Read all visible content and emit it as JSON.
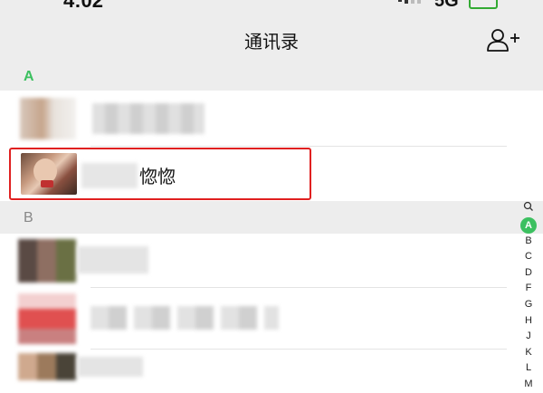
{
  "status_bar": {
    "time": "4:02",
    "network": "5G"
  },
  "header": {
    "title": "通讯录",
    "add_contact_icon": "add-contact-icon"
  },
  "sections": [
    {
      "letter": "A",
      "letter_color": "#3cc060"
    },
    {
      "letter": "B",
      "letter_color": "#888888"
    }
  ],
  "contacts": {
    "highlighted_name": "惚惚"
  },
  "index_bar": {
    "search_icon": "search-icon",
    "active": "A",
    "letters": [
      "B",
      "C",
      "D",
      "F",
      "G",
      "H",
      "J",
      "K",
      "L",
      "M"
    ]
  },
  "colors": {
    "accent": "#3cc060",
    "highlight_border": "#e02020",
    "header_bg": "#ededed"
  }
}
